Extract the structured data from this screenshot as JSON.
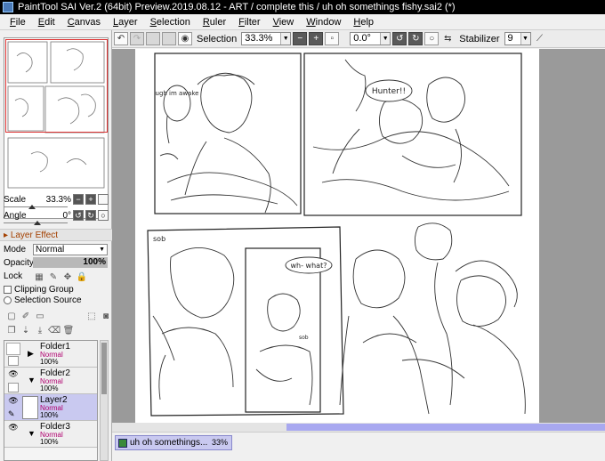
{
  "window": {
    "title": "PaintTool SAI Ver.2 (64bit) Preview.2019.08.12 - ART / complete this / uh oh somethings fishy.sai2 (*)"
  },
  "menu": [
    "File",
    "Edit",
    "Canvas",
    "Layer",
    "Selection",
    "Ruler",
    "Filter",
    "View",
    "Window",
    "Help"
  ],
  "toolbar": {
    "selection_label": "Selection",
    "zoom": "33.3%",
    "rotation": "0.0°",
    "stabilizer_label": "Stabilizer",
    "stabilizer_value": "9"
  },
  "navigator": {
    "scale_label": "Scale",
    "scale_value": "33.3%",
    "angle_label": "Angle",
    "angle_value": "0°"
  },
  "layer_effect": {
    "header": "Layer Effect",
    "mode_label": "Mode",
    "mode_value": "Normal",
    "opacity_label": "Opacity",
    "opacity_value": "100%",
    "lock_label": "Lock",
    "clipping_label": "Clipping Group",
    "selection_source_label": "Selection Source"
  },
  "layers": [
    {
      "name": "Folder1",
      "mode": "Normal",
      "opacity": "100%"
    },
    {
      "name": "Folder2",
      "mode": "Normal",
      "opacity": "100%"
    },
    {
      "name": "Layer2",
      "mode": "Normal",
      "opacity": "100%"
    },
    {
      "name": "Folder3",
      "mode": "Normal",
      "opacity": "100%"
    }
  ],
  "comic_text": {
    "bubble1": "ugh im awake",
    "bubble2": "Hunter!!",
    "sob": "sob",
    "bubble3": "wh- what?",
    "sob2": "sob"
  },
  "status": {
    "doc_name": "uh oh somethings...",
    "doc_zoom": "33%"
  }
}
